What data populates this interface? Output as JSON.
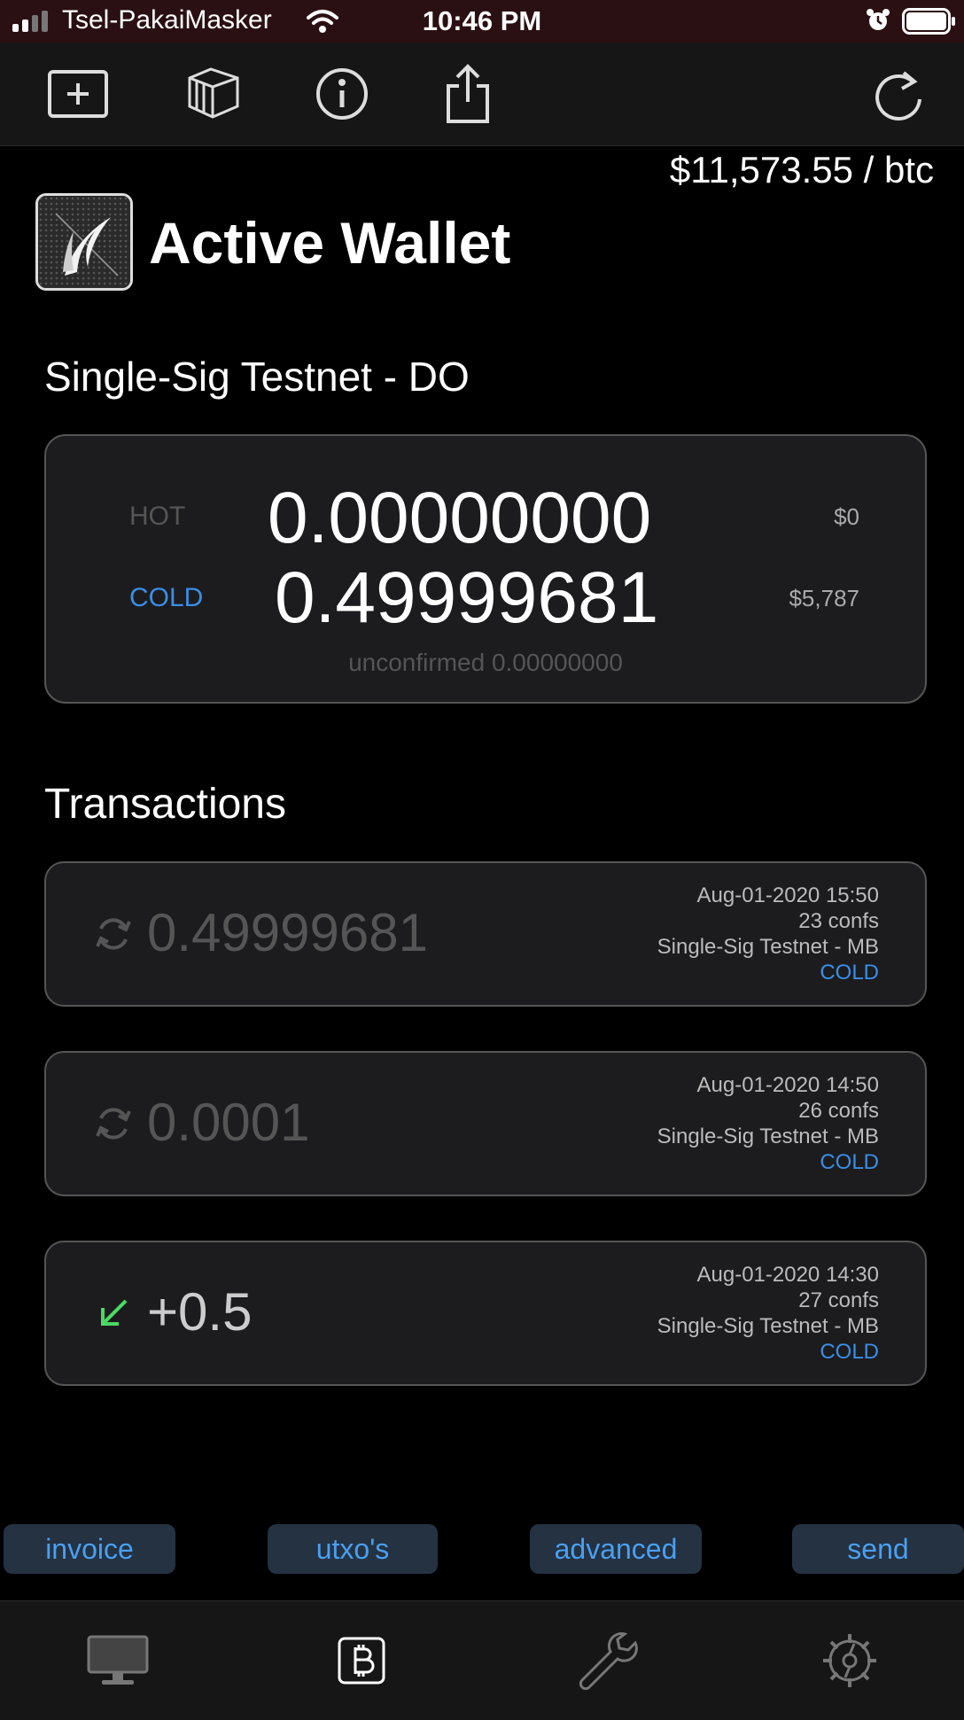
{
  "status_bar": {
    "carrier": "Tsel-PakaiMasker",
    "time": "10:46 PM"
  },
  "toolbar": {
    "icons": [
      "add-wallet-icon",
      "wallets-stack-icon",
      "info-icon",
      "share-icon",
      "refresh-icon"
    ]
  },
  "price": "$11,573.55 / btc",
  "header": {
    "title": "Active Wallet"
  },
  "wallet": {
    "name": "Single-Sig Testnet - DO",
    "hot_label": "HOT",
    "hot_amount": "0.00000000",
    "hot_fiat": "$0",
    "cold_label": "COLD",
    "cold_amount": "0.49999681",
    "cold_fiat": "$5,787",
    "unconfirmed": "unconfirmed 0.00000000"
  },
  "transactions": {
    "heading": "Transactions",
    "items": [
      {
        "amount": "0.49999681",
        "date": "Aug-01-2020 15:50",
        "confs": "23 confs",
        "wallet": "Single-Sig Testnet - MB",
        "type": "COLD",
        "icon": "pending-sync-icon"
      },
      {
        "amount": "0.0001",
        "date": "Aug-01-2020 14:50",
        "confs": "26 confs",
        "wallet": "Single-Sig Testnet - MB",
        "type": "COLD",
        "icon": "pending-sync-icon"
      },
      {
        "amount": "+0.5",
        "date": "Aug-01-2020 14:30",
        "confs": "27 confs",
        "wallet": "Single-Sig Testnet - MB",
        "type": "COLD",
        "icon": "received-arrow-icon"
      }
    ]
  },
  "actions": {
    "invoice": "invoice",
    "utxos": "utxo's",
    "advanced": "advanced",
    "send": "send"
  },
  "tabbar": {
    "icons": [
      "monitor-icon",
      "bitcoin-icon",
      "wrench-icon",
      "settings-icon"
    ]
  },
  "colors": {
    "accent": "#3a8ee6",
    "received": "#4cd964",
    "card": "#1c1c1e",
    "button_bg": "#243242"
  }
}
